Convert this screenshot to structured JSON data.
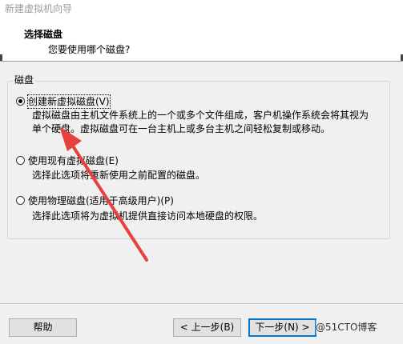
{
  "window": {
    "title": "新建虚拟机向导"
  },
  "header": {
    "title": "选择磁盘",
    "subtitle": "您要使用哪个磁盘?"
  },
  "group": {
    "label": "磁盘",
    "options": [
      {
        "label": "创建新虚拟磁盘(V)",
        "selected": true,
        "description": "虚拟磁盘由主机文件系统上的一个或多个文件组成，客户机操作系统会将其视为单个硬盘。虚拟磁盘可在一台主机上或多台主机之间轻松复制或移动。"
      },
      {
        "label": "使用现有虚拟磁盘(E)",
        "selected": false,
        "description": "选择此选项将重新使用之前配置的磁盘。"
      },
      {
        "label": "使用物理磁盘(适用于高级用户)(P)",
        "selected": false,
        "description": "选择此选项将为虚拟机提供直接访问本地硬盘的权限。"
      }
    ]
  },
  "buttons": {
    "help": "帮助",
    "back": "< 上一步(B)",
    "next": "下一步(N) >"
  },
  "watermark": "@51CTO博客",
  "colors": {
    "annotation_arrow": "#e8413c",
    "focus_border": "#0078d7"
  }
}
